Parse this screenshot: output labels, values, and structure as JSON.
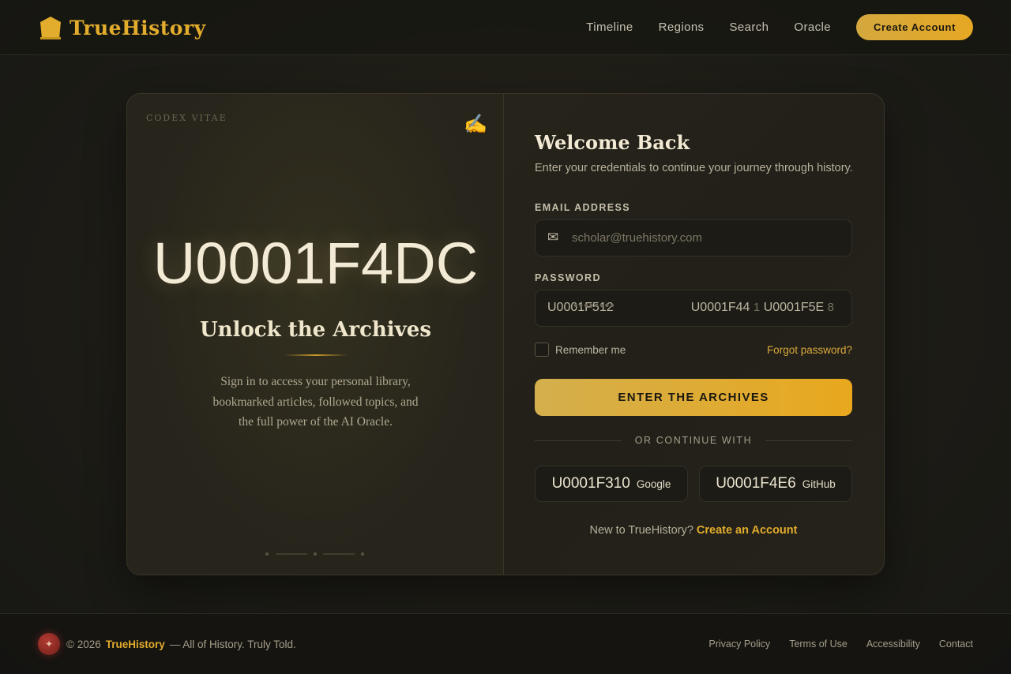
{
  "header": {
    "brand": "TrueHistory",
    "brand_icon": "temple-icon",
    "nav": [
      "Timeline",
      "Regions",
      "Search",
      "Oracle"
    ],
    "cta": "Create Account"
  },
  "hero": {
    "label": "CODEX VITAE",
    "corner_icon": "✍",
    "glyph": "U0001F4DC",
    "title": "Unlock the Archives",
    "description": "Sign in to access your personal library, bookmarked articles, followed topics, and the full power of the AI Oracle."
  },
  "form": {
    "title": "Welcome Back",
    "subtitle": "Enter your credentials to continue your journey through history.",
    "email_label": "EMAIL ADDRESS",
    "email_icon": "✉",
    "email_placeholder": "scholar@truehistory.com",
    "password_label": "PASSWORD",
    "password_value": "U0001F512",
    "password_mask": "••••••••",
    "password_toggle_glyph_a": "U0001F44",
    "password_toggle_digit_a": "1",
    "password_toggle_glyph_b": "U0001F5E",
    "password_toggle_digit_b": "8",
    "remember_label": "Remember me",
    "forgot_label": "Forgot password?",
    "submit_label": "ENTER THE ARCHIVES",
    "divider_label": "OR CONTINUE WITH",
    "social": [
      {
        "glyph": "U0001F310",
        "label": "Google"
      },
      {
        "glyph": "U0001F4E6",
        "label": "GitHub"
      }
    ],
    "signup_prompt": "New to TrueHistory?",
    "signup_link": "Create an Account"
  },
  "footer": {
    "badge_glyph": "✦",
    "copyright": "© 2026",
    "brand": "TrueHistory",
    "tagline": "— All of History. Truly Told.",
    "links": [
      "Privacy Policy",
      "Terms of Use",
      "Accessibility",
      "Contact"
    ]
  },
  "colors": {
    "accent": "#e2ac2c",
    "background": "#1d1c16",
    "card": "#25221a"
  }
}
